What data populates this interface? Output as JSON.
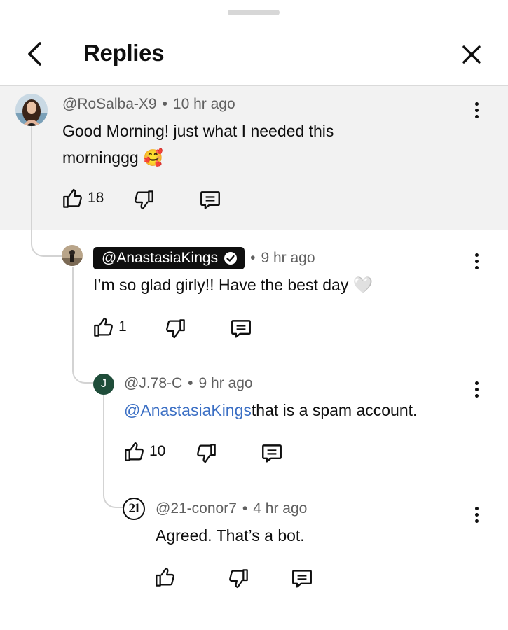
{
  "header": {
    "title": "Replies"
  },
  "comments": [
    {
      "handle": "@RoSalba-X9",
      "time": "10 hr ago",
      "text": "Good Morning! just what I needed this morninggg 🥰",
      "text_line1": "Good Morning! just what I needed this",
      "text_line2": "morninggg",
      "emoji": "🥰",
      "likes": "18",
      "highlighted": true
    },
    {
      "handle": "@AnastasiaKings",
      "verified": true,
      "time": "9 hr ago",
      "text": "I'm so glad girly!! Have the best day 🤍",
      "text_main": "I’m so glad girly!! Have the best day",
      "emoji": "🤍",
      "likes": "1"
    },
    {
      "handle": "@J.78-C",
      "avatar_letter": "J",
      "avatar_color": "#1f4d3a",
      "time": "9 hr ago",
      "mention": "@AnastasiaKings",
      "text_rest": "that is a spam account.",
      "likes": "10"
    },
    {
      "handle": "@21-conor7",
      "avatar_text": "21",
      "time": "4 hr ago",
      "text": "Agreed. That’s a bot.",
      "likes": ""
    }
  ],
  "meta_separator": "•",
  "icons": {
    "back": "chevron-left-icon",
    "close": "close-icon",
    "like": "thumb-up-icon",
    "dislike": "thumb-down-icon",
    "reply": "reply-comment-icon",
    "more": "more-vertical-icon",
    "verified": "verified-check-icon"
  },
  "colors": {
    "mention": "#3b6fc4",
    "highlight_bg": "#f2f2f2"
  }
}
